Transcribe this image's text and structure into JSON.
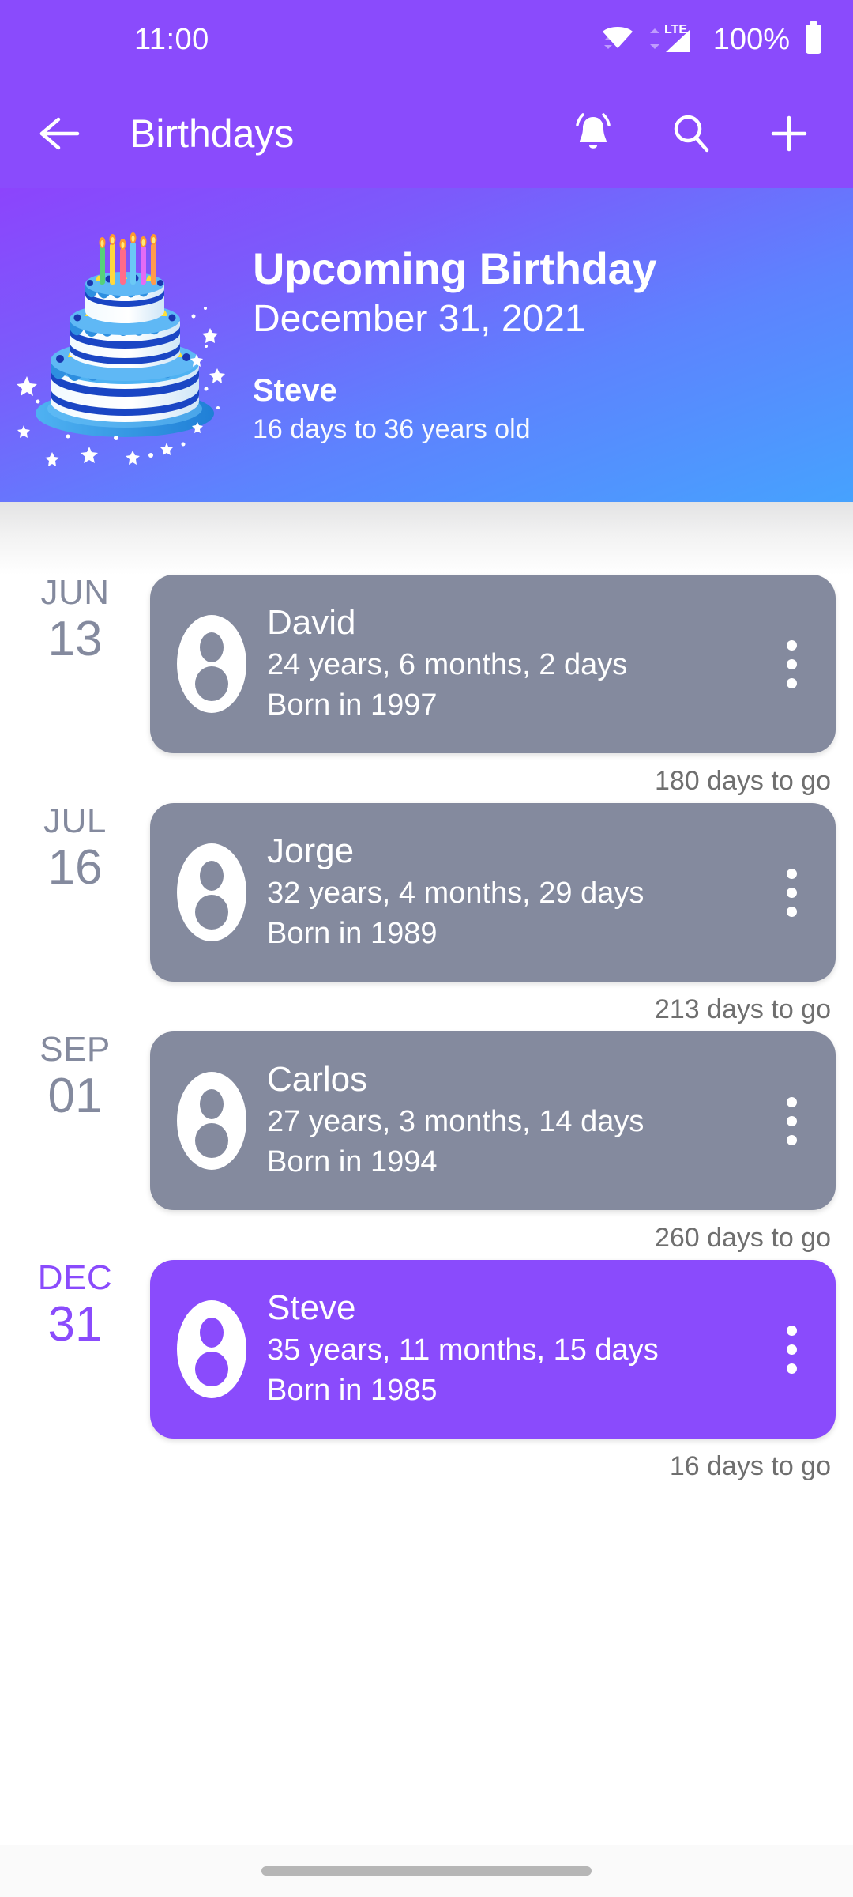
{
  "status_bar": {
    "time": "11:00",
    "battery_percent": "100%",
    "network_type": "LTE",
    "icons": [
      "wifi-icon",
      "lte-signal-icon",
      "battery-icon"
    ]
  },
  "app_bar": {
    "back_label": "back-arrow",
    "title": "Birthdays",
    "actions": [
      {
        "name": "notifications-button",
        "icon": "bell-icon"
      },
      {
        "name": "search-button",
        "icon": "search-icon"
      },
      {
        "name": "add-birthday-button",
        "icon": "plus-icon"
      }
    ]
  },
  "hero": {
    "title": "Upcoming Birthday",
    "date": "December 31, 2021",
    "name": "Steve",
    "subtitle": "16 days to 36 years old",
    "illustration": "birthday-cake-illustration"
  },
  "list": {
    "rows": [
      {
        "month": "JUN",
        "day": "13",
        "name": "David",
        "age": "24 years, 6 months, 2 days",
        "born": "Born in 1997",
        "days_to_go": "180 days to go",
        "highlighted": false
      },
      {
        "month": "JUL",
        "day": "16",
        "name": "Jorge",
        "age": "32 years, 4 months, 29 days",
        "born": "Born in 1989",
        "days_to_go": "213 days to go",
        "highlighted": false
      },
      {
        "month": "SEP",
        "day": "01",
        "name": "Carlos",
        "age": "27 years, 3 months, 14 days",
        "born": "Born in 1994",
        "days_to_go": "260 days to go",
        "highlighted": false
      },
      {
        "month": "DEC",
        "day": "31",
        "name": "Steve",
        "age": "35 years, 11 months, 15 days",
        "born": "Born in 1985",
        "days_to_go": "16 days to go",
        "highlighted": true
      }
    ]
  },
  "colors": {
    "accent_purple": "#8A4BFC",
    "card_gray": "#848A9E",
    "hero_gradient_start": "#8C44FC",
    "hero_gradient_end": "#46A2FE",
    "muted_text": "#6f6f6f"
  },
  "navigation": {
    "gesture_pill": "home-gesture-pill"
  }
}
